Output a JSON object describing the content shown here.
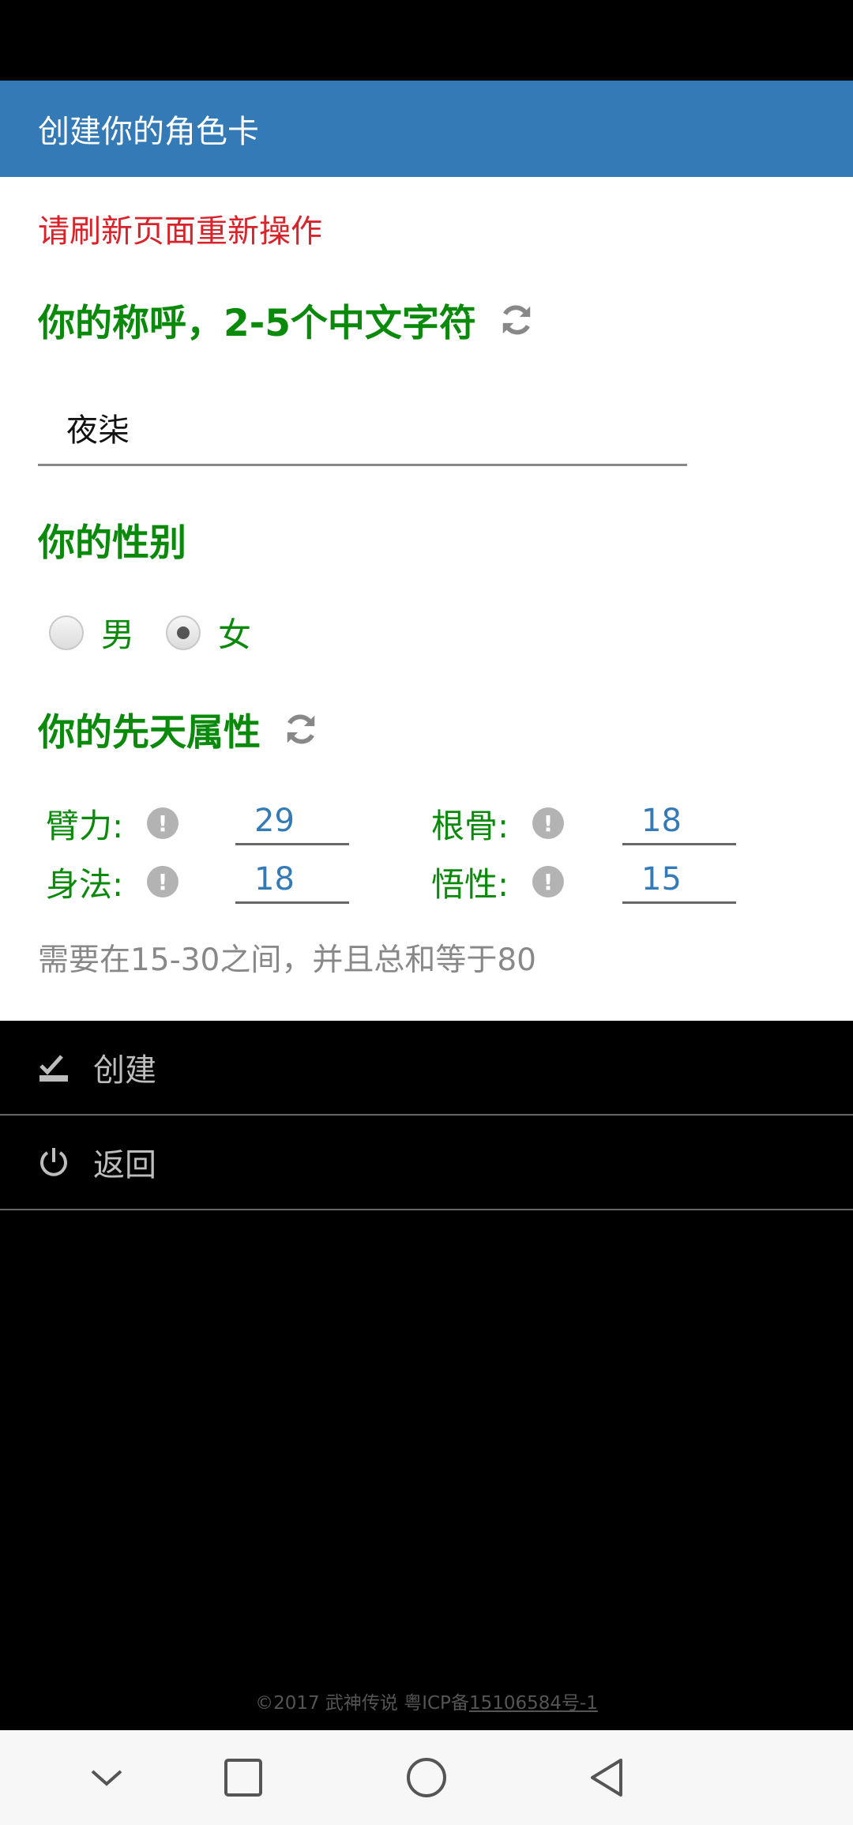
{
  "header": {
    "title": "创建你的角色卡"
  },
  "error_message": "请刷新页面重新操作",
  "name_section": {
    "title": "你的称呼，2-5个中文字符",
    "value": "夜柒"
  },
  "gender_section": {
    "title": "你的性别",
    "options": [
      {
        "label": "男",
        "checked": false
      },
      {
        "label": "女",
        "checked": true
      }
    ]
  },
  "attributes_section": {
    "title": "你的先天属性",
    "items": [
      {
        "label": "臂力:",
        "value": "29"
      },
      {
        "label": "根骨:",
        "value": "18"
      },
      {
        "label": "身法:",
        "value": "18"
      },
      {
        "label": "悟性:",
        "value": "15"
      }
    ],
    "hint": "需要在15-30之间，并且总和等于80"
  },
  "menu": [
    {
      "label": "创建",
      "icon": "create-icon"
    },
    {
      "label": "返回",
      "icon": "power-icon"
    }
  ],
  "footer": {
    "copyright": "©2017 武神传说 粤ICP备",
    "icp_link": "15106584号-1"
  }
}
